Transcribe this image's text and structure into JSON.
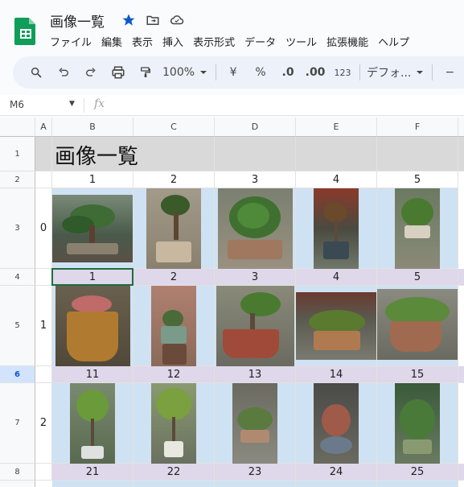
{
  "app": {
    "title": "画像一覧",
    "menu": [
      "ファイル",
      "編集",
      "表示",
      "挿入",
      "表示形式",
      "データ",
      "ツール",
      "拡張機能",
      "ヘルプ"
    ]
  },
  "toolbar": {
    "zoom": "100%",
    "currency": "¥",
    "percent": "%",
    "dec_decrease": ".0",
    "dec_increase": ".00",
    "num_format": "123",
    "font": "デフォ...",
    "minus": "−"
  },
  "formula_bar": {
    "cell_ref": "M6",
    "fx": "fx"
  },
  "columns": [
    "A",
    "B",
    "C",
    "D",
    "E",
    "F"
  ],
  "rows": [
    "1",
    "2",
    "3",
    "4",
    "5",
    "6",
    "7",
    "8"
  ],
  "sheet": {
    "title": "画像一覧",
    "row2_numbers": [
      "1",
      "2",
      "3",
      "4",
      "5"
    ],
    "row3_index": "0",
    "row4_numbers": [
      "1",
      "2",
      "3",
      "4",
      "5"
    ],
    "row5_index": "1",
    "row6_numbers": [
      "11",
      "12",
      "13",
      "14",
      "15"
    ],
    "row7_index": "2",
    "row8_numbers": [
      "21",
      "22",
      "23",
      "24",
      "25"
    ]
  },
  "colors": {
    "accent_blue": "#cfe2f3",
    "lavender": "#dfd7ea",
    "title_gray": "#d9d9d9",
    "sheets_green": "#0f9d58",
    "selection_green": "#1e6e3c"
  }
}
